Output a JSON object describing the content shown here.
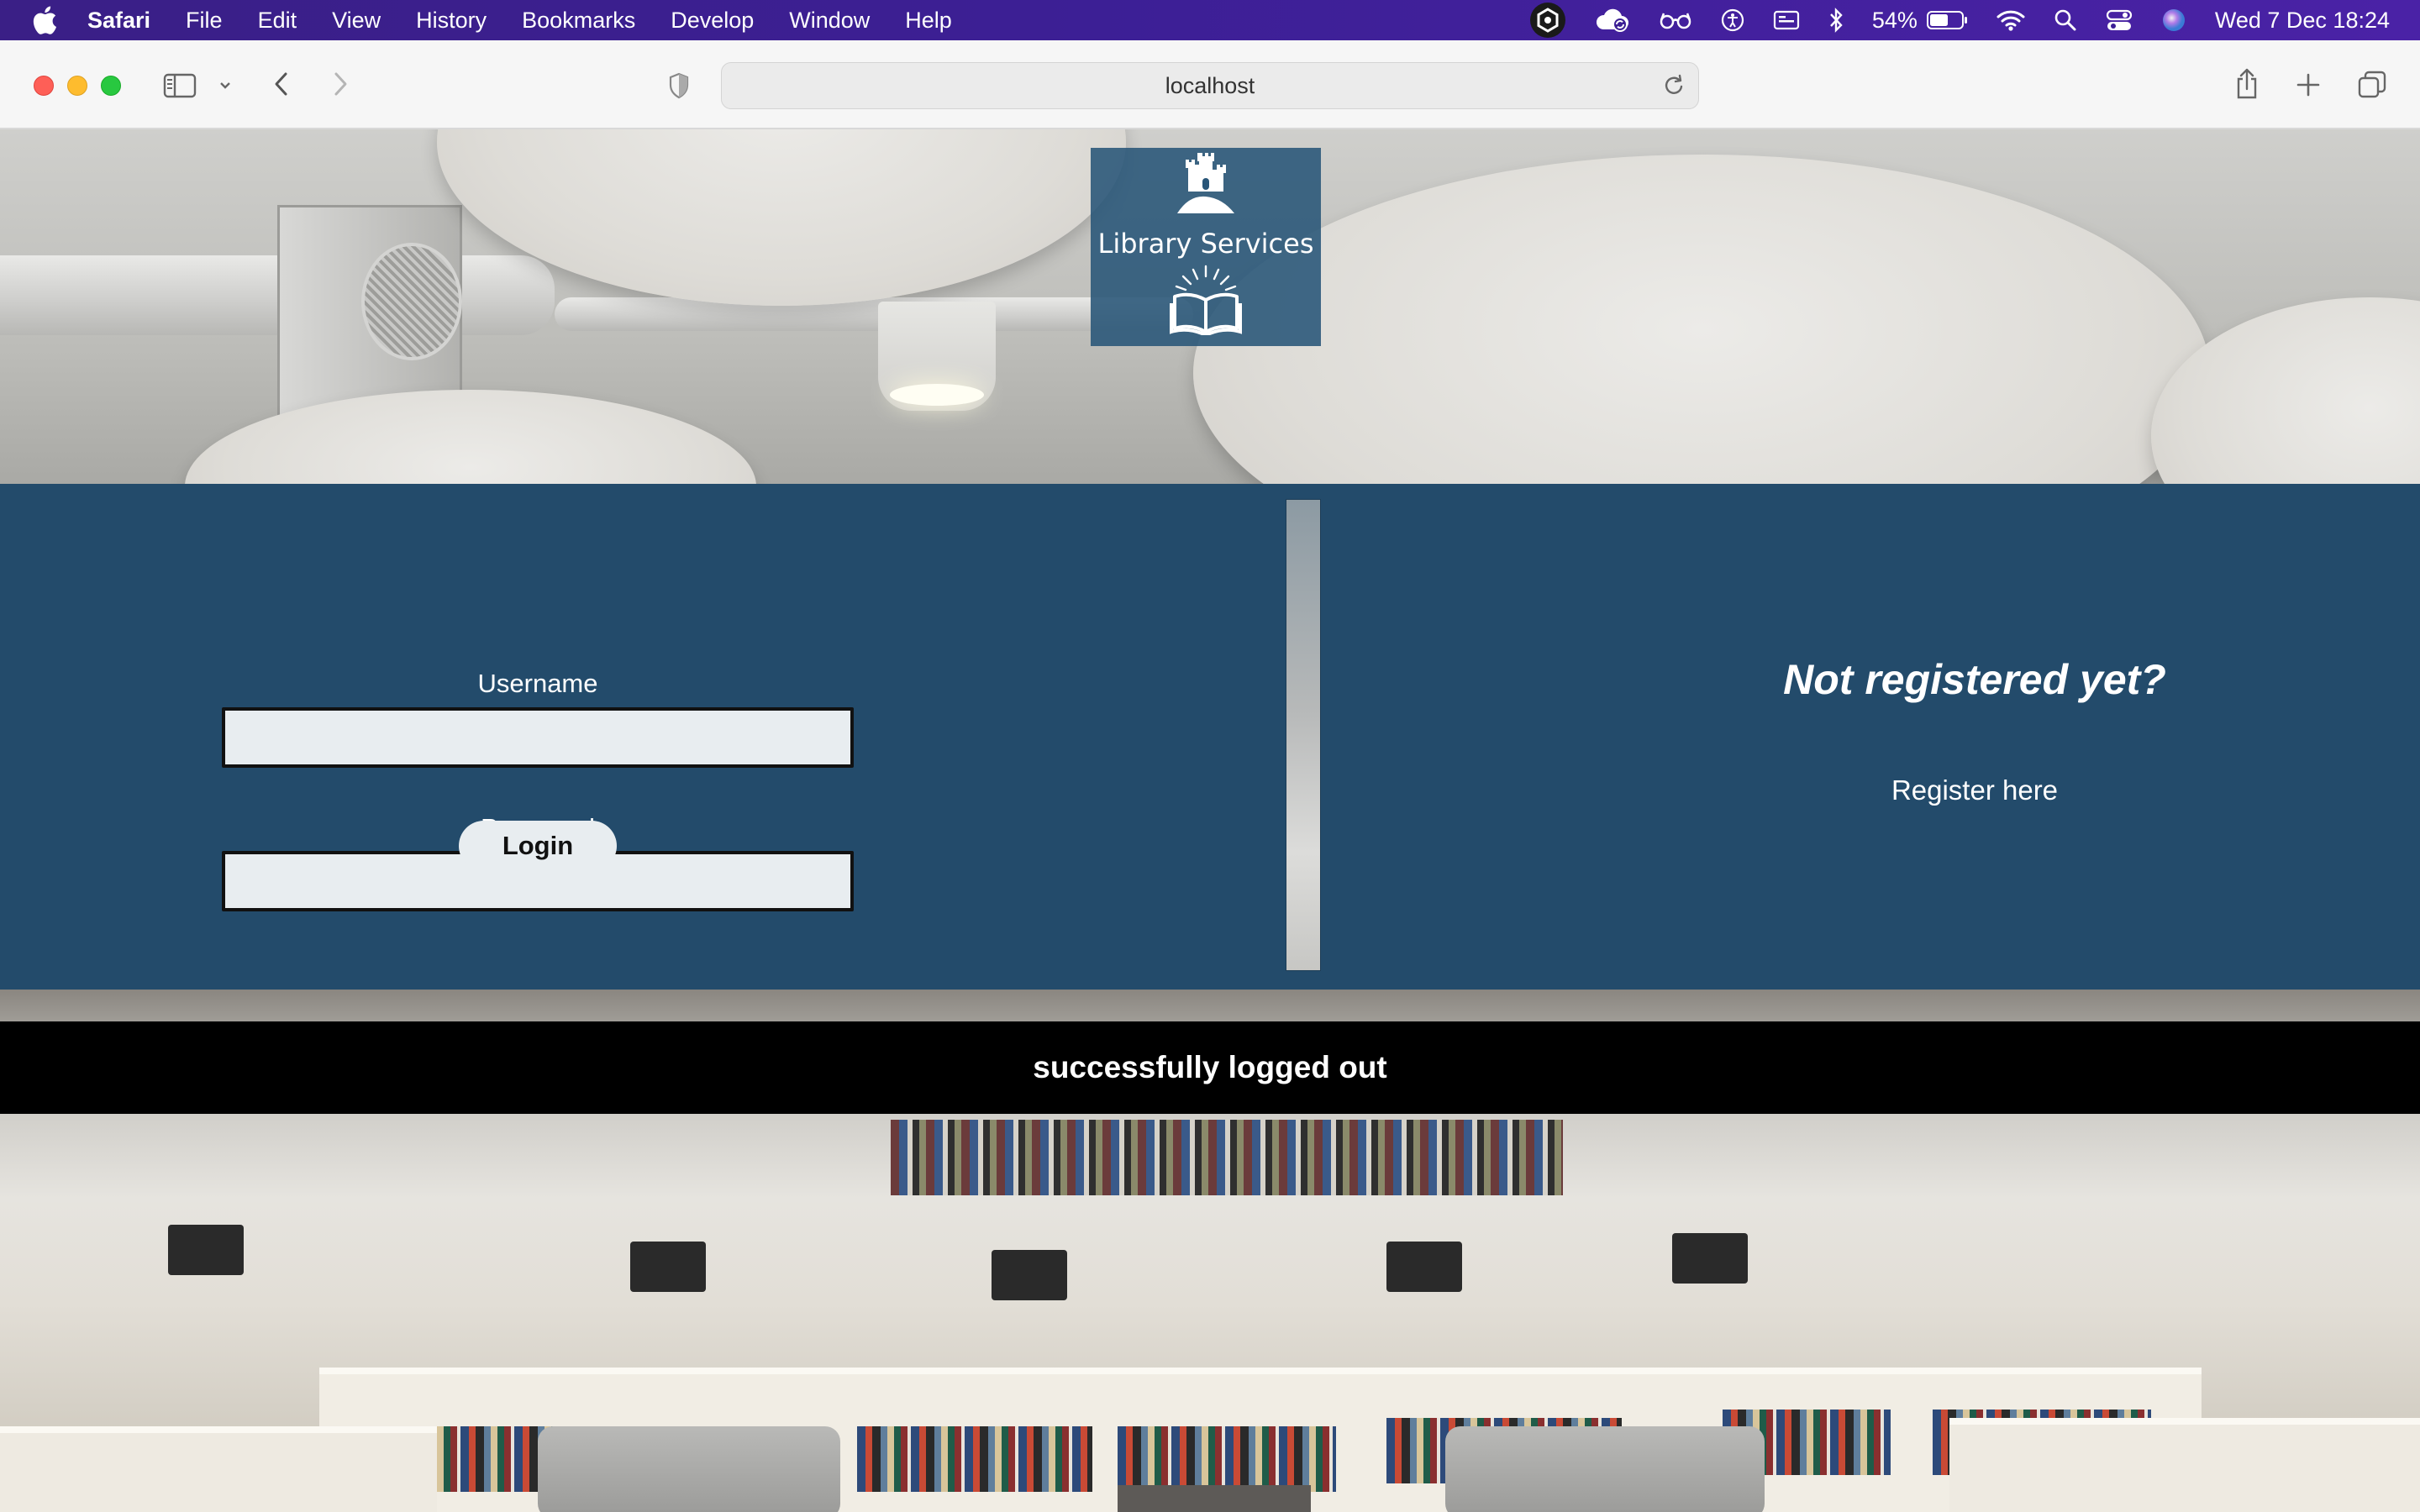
{
  "menubar": {
    "app_name": "Safari",
    "items": [
      "File",
      "Edit",
      "View",
      "History",
      "Bookmarks",
      "Develop",
      "Window",
      "Help"
    ],
    "battery": "54%",
    "clock": "Wed 7 Dec  18:24",
    "icons": [
      "apple-icon",
      "app-badge-icon",
      "cloud-sync-icon",
      "glasses-icon",
      "accessibility-icon",
      "display-icon",
      "bluetooth-icon",
      "battery-icon",
      "wifi-icon",
      "spotlight-search-icon",
      "control-center-icon",
      "siri-icon"
    ]
  },
  "browser": {
    "address": "localhost",
    "icons": [
      "sidebar-icon",
      "chevron-down-icon",
      "back-icon",
      "forward-icon",
      "privacy-shield-icon",
      "reload-icon",
      "share-icon",
      "new-tab-icon",
      "tab-overview-icon"
    ]
  },
  "logo": {
    "text": "Library Services",
    "icons": [
      "castle-icon",
      "open-book-icon"
    ]
  },
  "login": {
    "username_label": "Username",
    "username_value": "",
    "password_label": "Password",
    "password_value": "",
    "login_button": "Login"
  },
  "register": {
    "heading": "Not registered yet?",
    "link": "Register here"
  },
  "flash_message": "successfully logged out",
  "colors": {
    "menubar": "#3c1f95",
    "panel": "#234b6b",
    "logo_box": "#285578",
    "input_bg": "#e8edf0",
    "flash_bg": "#000000"
  }
}
